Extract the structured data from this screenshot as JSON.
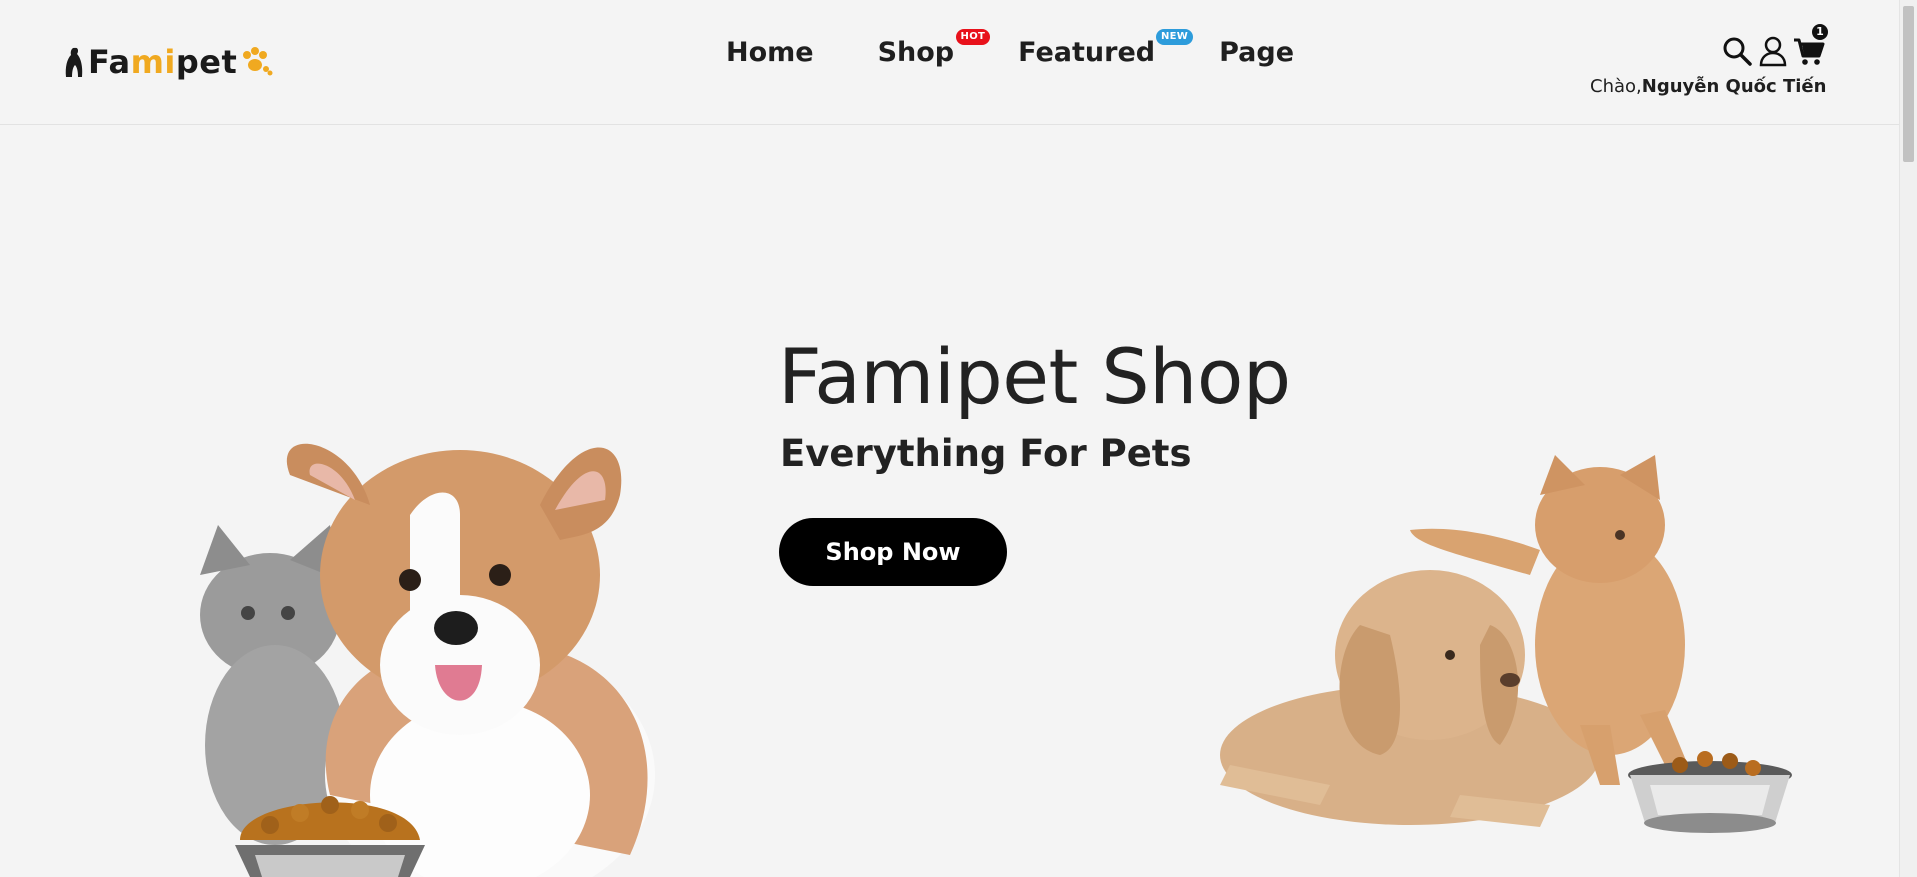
{
  "header": {
    "logo": {
      "part1": "Fa",
      "part2": "mi",
      "part3": "pet"
    },
    "nav": [
      {
        "label": "Home"
      },
      {
        "label": "Shop",
        "badge": "HOT"
      },
      {
        "label": "Featured",
        "badge": "NEW"
      },
      {
        "label": "Page"
      }
    ],
    "cart_count": "1",
    "greeting": {
      "prefix": "Chào,",
      "name": "Nguyễn Quốc Tiến"
    }
  },
  "hero": {
    "title": "Famipet Shop",
    "subtitle": "Everything For Pets",
    "cta_label": "Shop Now"
  },
  "colors": {
    "brand_accent": "#f0a920",
    "hot_badge": "#e8111b",
    "new_badge": "#2d9cdb",
    "cta": "#000000"
  },
  "icons": [
    "search-icon",
    "user-icon",
    "cart-icon",
    "paw-icon"
  ]
}
